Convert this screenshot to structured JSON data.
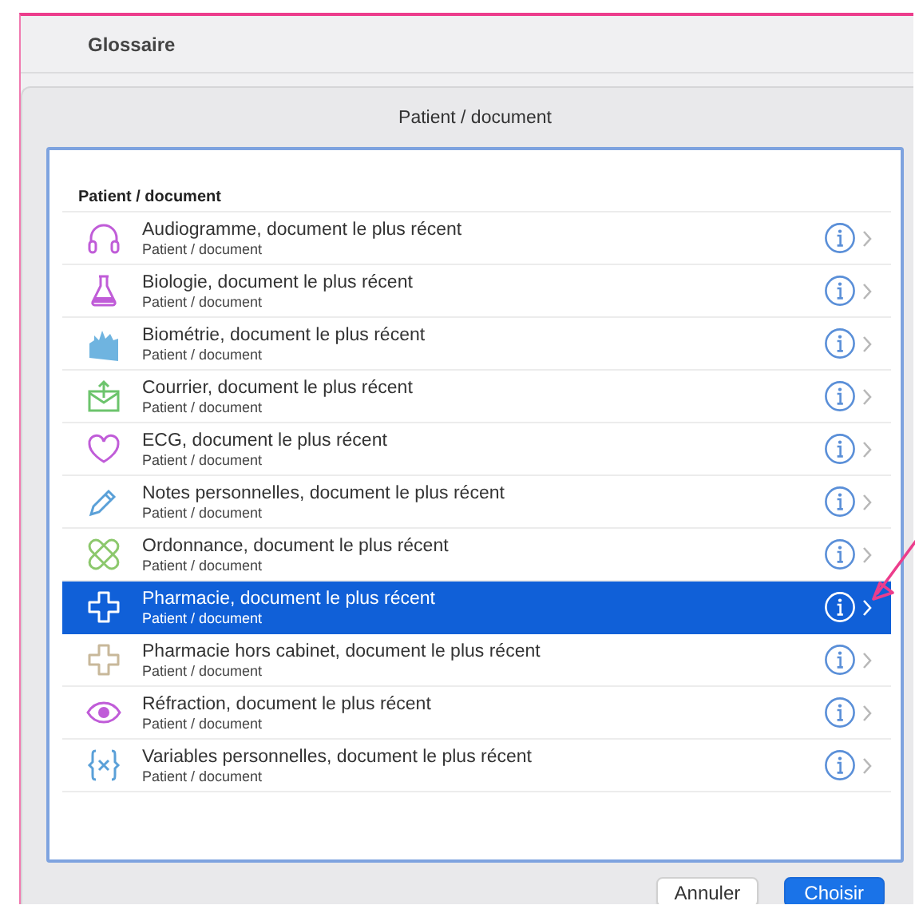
{
  "window": {
    "title": "Glossaire"
  },
  "sheet": {
    "title": "Patient / document"
  },
  "list": {
    "header": "Patient / document",
    "rows": [
      {
        "kind": "headphones",
        "title": "Audiogramme, document le plus récent",
        "subtitle": "Patient / document",
        "selected": false
      },
      {
        "kind": "flask",
        "title": "Biologie, document le plus récent",
        "subtitle": "Patient / document",
        "selected": false
      },
      {
        "kind": "chart",
        "title": "Biométrie, document le plus récent",
        "subtitle": "Patient / document",
        "selected": false
      },
      {
        "kind": "envelope",
        "title": "Courrier, document le plus récent",
        "subtitle": "Patient / document",
        "selected": false
      },
      {
        "kind": "heart",
        "title": "ECG, document le plus récent",
        "subtitle": "Patient / document",
        "selected": false
      },
      {
        "kind": "pencil",
        "title": "Notes personnelles, document le plus récent",
        "subtitle": "Patient / document",
        "selected": false
      },
      {
        "kind": "bandage",
        "title": "Ordonnance, document le plus récent",
        "subtitle": "Patient / document",
        "selected": false
      },
      {
        "kind": "cross",
        "title": "Pharmacie, document le plus récent",
        "subtitle": "Patient / document",
        "selected": true
      },
      {
        "kind": "cross-outline",
        "title": "Pharmacie hors cabinet, document le plus récent",
        "subtitle": "Patient / document",
        "selected": false
      },
      {
        "kind": "eye",
        "title": "Réfraction, document le plus récent",
        "subtitle": "Patient / document",
        "selected": false
      },
      {
        "kind": "braces",
        "title": "Variables personnelles, document le plus récent",
        "subtitle": "Patient / document",
        "selected": false
      }
    ]
  },
  "buttons": [
    {
      "label": "Annuler",
      "kind": "cancel"
    },
    {
      "label": "Choisir",
      "kind": "default"
    }
  ]
}
